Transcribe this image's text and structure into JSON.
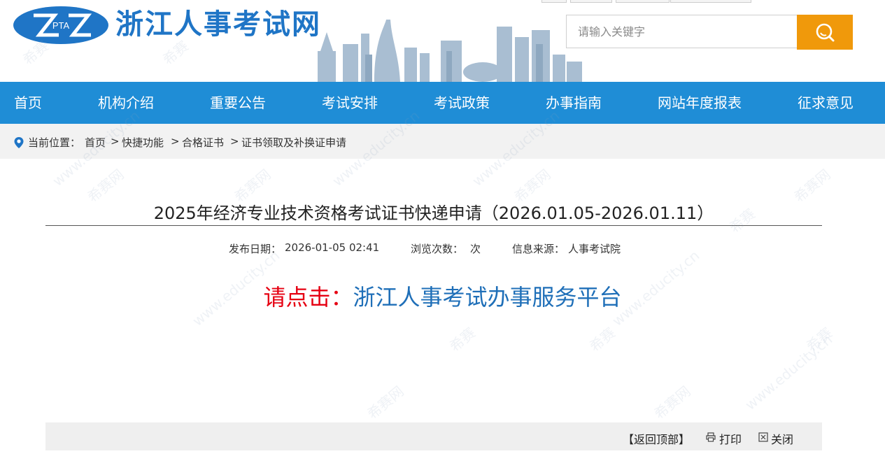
{
  "header": {
    "site_title": "浙江人事考试网",
    "logo_text": "PTA",
    "search": {
      "placeholder": "请输入关键字"
    },
    "colors": {
      "brand_blue": "#1f75c6",
      "accent_orange": "#f0990b"
    }
  },
  "nav": {
    "items": [
      {
        "label": "首页"
      },
      {
        "label": "机构介绍"
      },
      {
        "label": "重要公告"
      },
      {
        "label": "考试安排"
      },
      {
        "label": "考试政策"
      },
      {
        "label": "办事指南"
      },
      {
        "label": "网站年度报表"
      },
      {
        "label": "征求意见"
      }
    ],
    "color": "#1f8dd6"
  },
  "breadcrumb": {
    "label": "当前位置：",
    "items": [
      {
        "label": "首页"
      },
      {
        "label": "快捷功能"
      },
      {
        "label": "合格证书"
      },
      {
        "label": "证书领取及补换证申请"
      }
    ],
    "separator": ">"
  },
  "article": {
    "title": "2025年经济专业技术资格考试证书快递申请（2026.01.05-2026.01.11）",
    "meta": {
      "publish_label": "发布日期：",
      "publish_date": "2026-01-05 02:41",
      "views_label": "浏览次数：",
      "views_unit": "次",
      "source_label": "信息来源：",
      "source": "人事考试院"
    },
    "cta_prefix": "请点击：",
    "cta_link": "浙江人事考试办事服务平台"
  },
  "footer_actions": {
    "back_to_top": "【返回顶部】",
    "print": "打印",
    "close": "关闭"
  },
  "watermark": {
    "brand": "希赛",
    "brand_net": "希赛网",
    "url": "www.educity.cn"
  }
}
